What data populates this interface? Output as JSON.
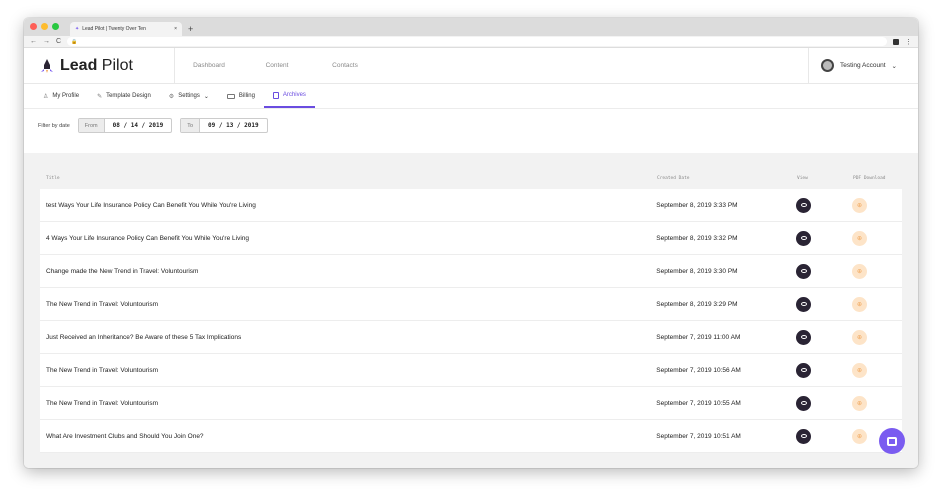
{
  "browser": {
    "tab_title": "Lead Pilot | Twenty Over Ten",
    "tab_close": "×",
    "new_tab": "+",
    "nav_back": "←",
    "nav_forward": "→",
    "nav_reload": "C",
    "lock": "🔒"
  },
  "header": {
    "brand_bold": "Lead",
    "brand_light": " Pilot",
    "nav": [
      "Dashboard",
      "Content",
      "Contacts"
    ],
    "account": "Testing Account",
    "account_chevron": "⌄"
  },
  "subnav": {
    "items": [
      {
        "label": "My Profile",
        "icon": "person-icon"
      },
      {
        "label": "Template Design",
        "icon": "brush-icon"
      },
      {
        "label": "Settings",
        "icon": "gear-icon"
      },
      {
        "label": "Billing",
        "icon": "card-icon"
      },
      {
        "label": "Archives",
        "icon": "archive-icon"
      }
    ],
    "active": "Archives"
  },
  "filter": {
    "label": "Filter by date",
    "from_label": "From",
    "from_value": "08 / 14 / 2019",
    "to_label": "To",
    "to_value": "09 / 13 / 2019"
  },
  "table": {
    "headers": {
      "title": "Title",
      "date": "Created Date",
      "view": "View",
      "pdf": "PDF Download"
    },
    "rows": [
      {
        "title": "test Ways Your Life Insurance Policy Can Benefit You While You're Living",
        "date": "September 8, 2019 3:33 PM"
      },
      {
        "title": "4 Ways Your Life Insurance Policy Can Benefit You While You're Living",
        "date": "September 8, 2019 3:32 PM"
      },
      {
        "title": "Change made the New Trend in Travel: Voluntourism",
        "date": "September 8, 2019 3:30 PM"
      },
      {
        "title": "The New Trend in Travel: Voluntourism",
        "date": "September 8, 2019 3:29 PM"
      },
      {
        "title": "Just Received an Inheritance? Be Aware of these 5 Tax Implications",
        "date": "September 7, 2019 11:00 AM"
      },
      {
        "title": "The New Trend in Travel: Voluntourism",
        "date": "September 7, 2019 10:56 AM"
      },
      {
        "title": "The New Trend in Travel: Voluntourism",
        "date": "September 7, 2019 10:55 AM"
      },
      {
        "title": "What Are Investment Clubs and Should You Join One?",
        "date": "September 7, 2019 10:51 AM"
      }
    ]
  },
  "colors": {
    "accent": "#6a4ce0",
    "eye_bg": "#2a2434",
    "pdf_bg": "#fde4c8",
    "chat_bg": "#7a5cf0"
  }
}
